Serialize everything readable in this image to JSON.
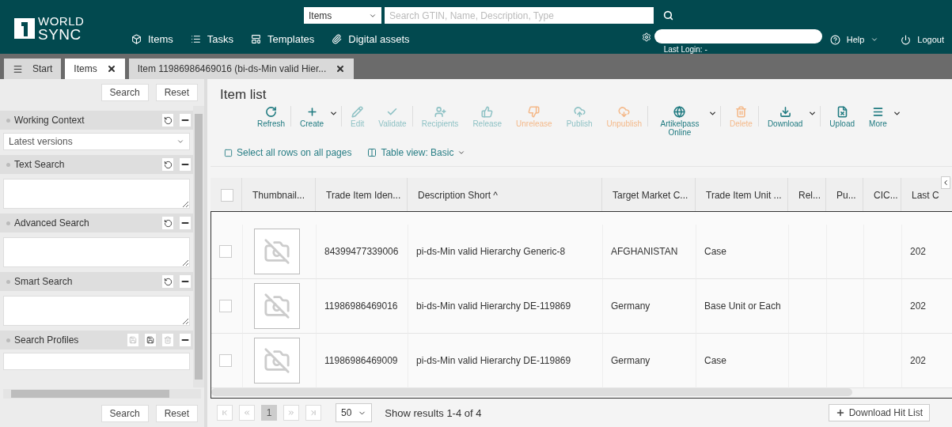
{
  "header": {
    "logo": {
      "line1": "WORLD",
      "line2": "SYNC"
    },
    "nav": [
      {
        "label": "Items"
      },
      {
        "label": "Tasks"
      },
      {
        "label": "Templates"
      },
      {
        "label": "Digital assets"
      }
    ],
    "search": {
      "scope": "Items",
      "placeholder": "Search GTIN, Name, Description, Type"
    },
    "user": {
      "last_login": "Last Login: -"
    },
    "help": "Help",
    "logout": "Logout"
  },
  "tabs": [
    {
      "label": "Start",
      "selected": false,
      "closable": false
    },
    {
      "label": "Items",
      "selected": true,
      "closable": true
    },
    {
      "label": "Item 11986986469016 (bi-ds-Min valid Hier...",
      "selected": false,
      "closable": true
    }
  ],
  "sidebar": {
    "top_buttons": [
      "Search",
      "Reset"
    ],
    "bottom_buttons": [
      "Search",
      "Reset"
    ],
    "sections": [
      {
        "title": "Working Context",
        "kind": "select",
        "value": "Latest versions"
      },
      {
        "title": "Text Search",
        "kind": "textarea"
      },
      {
        "title": "Advanced Search",
        "kind": "textarea"
      },
      {
        "title": "Smart Search",
        "kind": "textarea"
      },
      {
        "title": "Search Profiles",
        "kind": "profiles"
      }
    ]
  },
  "main": {
    "title": "Item list",
    "toolbar": [
      {
        "label": "Refresh",
        "kind": "normal",
        "disabled": false,
        "dropdown": false,
        "divider": true
      },
      {
        "label": "Create",
        "kind": "normal",
        "disabled": false,
        "dropdown": true,
        "divider": true
      },
      {
        "label": "Edit",
        "kind": "normal",
        "disabled": true,
        "dropdown": false,
        "divider": false
      },
      {
        "label": "Validate",
        "kind": "normal",
        "disabled": true,
        "dropdown": false,
        "divider": true
      },
      {
        "label": "Recipients",
        "kind": "normal",
        "disabled": true,
        "dropdown": false,
        "divider": false
      },
      {
        "label": "Release",
        "kind": "normal",
        "disabled": true,
        "dropdown": false,
        "divider": false
      },
      {
        "label": "Unrelease",
        "kind": "warning",
        "disabled": true,
        "dropdown": false,
        "divider": false
      },
      {
        "label": "Publish",
        "kind": "normal",
        "disabled": true,
        "dropdown": false,
        "divider": false
      },
      {
        "label": "Unpublish",
        "kind": "warning",
        "disabled": true,
        "dropdown": false,
        "divider": true
      },
      {
        "label": "Artikelpass Online",
        "kind": "normal",
        "disabled": false,
        "dropdown": true,
        "divider": true
      },
      {
        "label": "Delete",
        "kind": "warning",
        "disabled": true,
        "dropdown": false,
        "divider": true
      },
      {
        "label": "Download",
        "kind": "normal",
        "disabled": false,
        "dropdown": true,
        "divider": true
      },
      {
        "label": "Upload",
        "kind": "normal",
        "disabled": false,
        "dropdown": false,
        "divider": false
      },
      {
        "label": "More",
        "kind": "normal",
        "disabled": false,
        "dropdown": true,
        "divider": false
      }
    ],
    "select_all": {
      "label": "Select all rows on all pages",
      "checked": false
    },
    "table_view": "Table view: Basic",
    "table": {
      "all_checked": false,
      "columns": [
        {
          "label": "Thumbnail..."
        },
        {
          "label": "Trade Item Iden..."
        },
        {
          "label": "Description Short ^"
        },
        {
          "label": "Target Market C..."
        },
        {
          "label": "Trade Item Unit ..."
        },
        {
          "label": "Rel..."
        },
        {
          "label": "Pu..."
        },
        {
          "label": "CIC..."
        },
        {
          "label": "Last C"
        }
      ],
      "rows": [
        {
          "selected": false,
          "cells": [
            "",
            "84399477339006",
            "pi-ds-Min valid Hierarchy Generic-8",
            "AFGHANISTAN",
            "Case",
            "",
            "",
            "",
            "202"
          ]
        },
        {
          "selected": false,
          "cells": [
            "",
            "11986986469016",
            "bi-ds-Min valid Hierarchy DE-119869",
            "Germany",
            "Base Unit or Each",
            "",
            "",
            "",
            "202"
          ]
        },
        {
          "selected": false,
          "cells": [
            "",
            "11986986469009",
            "pi-ds-Min valid Hierarchy DE-119869",
            "Germany",
            "Case",
            "",
            "",
            "",
            "202"
          ]
        }
      ]
    },
    "pager": {
      "page": "1",
      "page_size": "50",
      "summary": "Show results 1-4 of 4",
      "download": "Download Hit List"
    }
  }
}
